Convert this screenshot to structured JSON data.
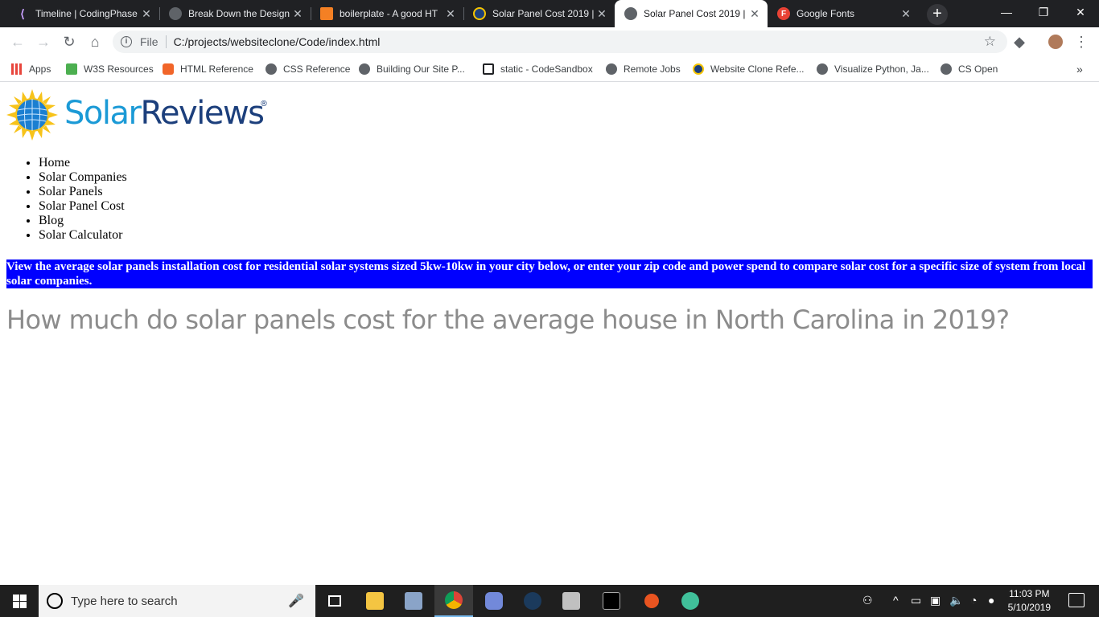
{
  "browser": {
    "tabs": [
      {
        "title": "Timeline | CodingPhase",
        "active": false
      },
      {
        "title": "Break Down the Design",
        "active": false
      },
      {
        "title": "boilerplate - A good HT",
        "active": false
      },
      {
        "title": "Solar Panel Cost 2019 |",
        "active": false
      },
      {
        "title": "Solar Panel Cost 2019 |",
        "active": true
      },
      {
        "title": "Google Fonts",
        "active": false
      }
    ],
    "url_scheme": "File",
    "url": "C:/projects/websiteclone/Code/index.html",
    "bookmarks": [
      {
        "label": "Apps",
        "icon": "apps-grid-icon"
      },
      {
        "label": "W3S Resources",
        "icon": "w3schools-icon"
      },
      {
        "label": "HTML Reference",
        "icon": "html5-icon"
      },
      {
        "label": "CSS Reference",
        "icon": "globe-icon"
      },
      {
        "label": "Building Our Site P...",
        "icon": "globe-icon"
      },
      {
        "label": "static - CodeSandbox",
        "icon": "codesandbox-icon"
      },
      {
        "label": "Remote Jobs",
        "icon": "globe-icon"
      },
      {
        "label": "Website Clone Refe...",
        "icon": "solar-icon"
      },
      {
        "label": "Visualize Python, Ja...",
        "icon": "globe-icon"
      },
      {
        "label": "CS Open",
        "icon": "globe-icon"
      }
    ],
    "more_bookmarks": "»"
  },
  "page": {
    "logo": {
      "part1": "Solar",
      "part2": "Reviews",
      "mark": "®"
    },
    "nav": [
      "Home",
      "Solar Companies",
      "Solar Panels",
      "Solar Panel Cost",
      "Blog",
      "Solar Calculator"
    ],
    "banner": "View the average solar panels installation cost for residential solar systems sized 5kw-10kw in your city below, or enter your zip code and power spend to compare solar cost for a specific size of system from local solar companies.",
    "headline": "How much do solar panels cost for the average house in North Carolina in 2019?",
    "colors": {
      "banner_bg": "#0000ff",
      "logo_light": "#1b9ad6",
      "logo_dark": "#1c3f7c",
      "headline": "#8c8c8c"
    }
  },
  "taskbar": {
    "search_placeholder": "Type here to search",
    "time": "11:03 PM",
    "date": "5/10/2019"
  }
}
